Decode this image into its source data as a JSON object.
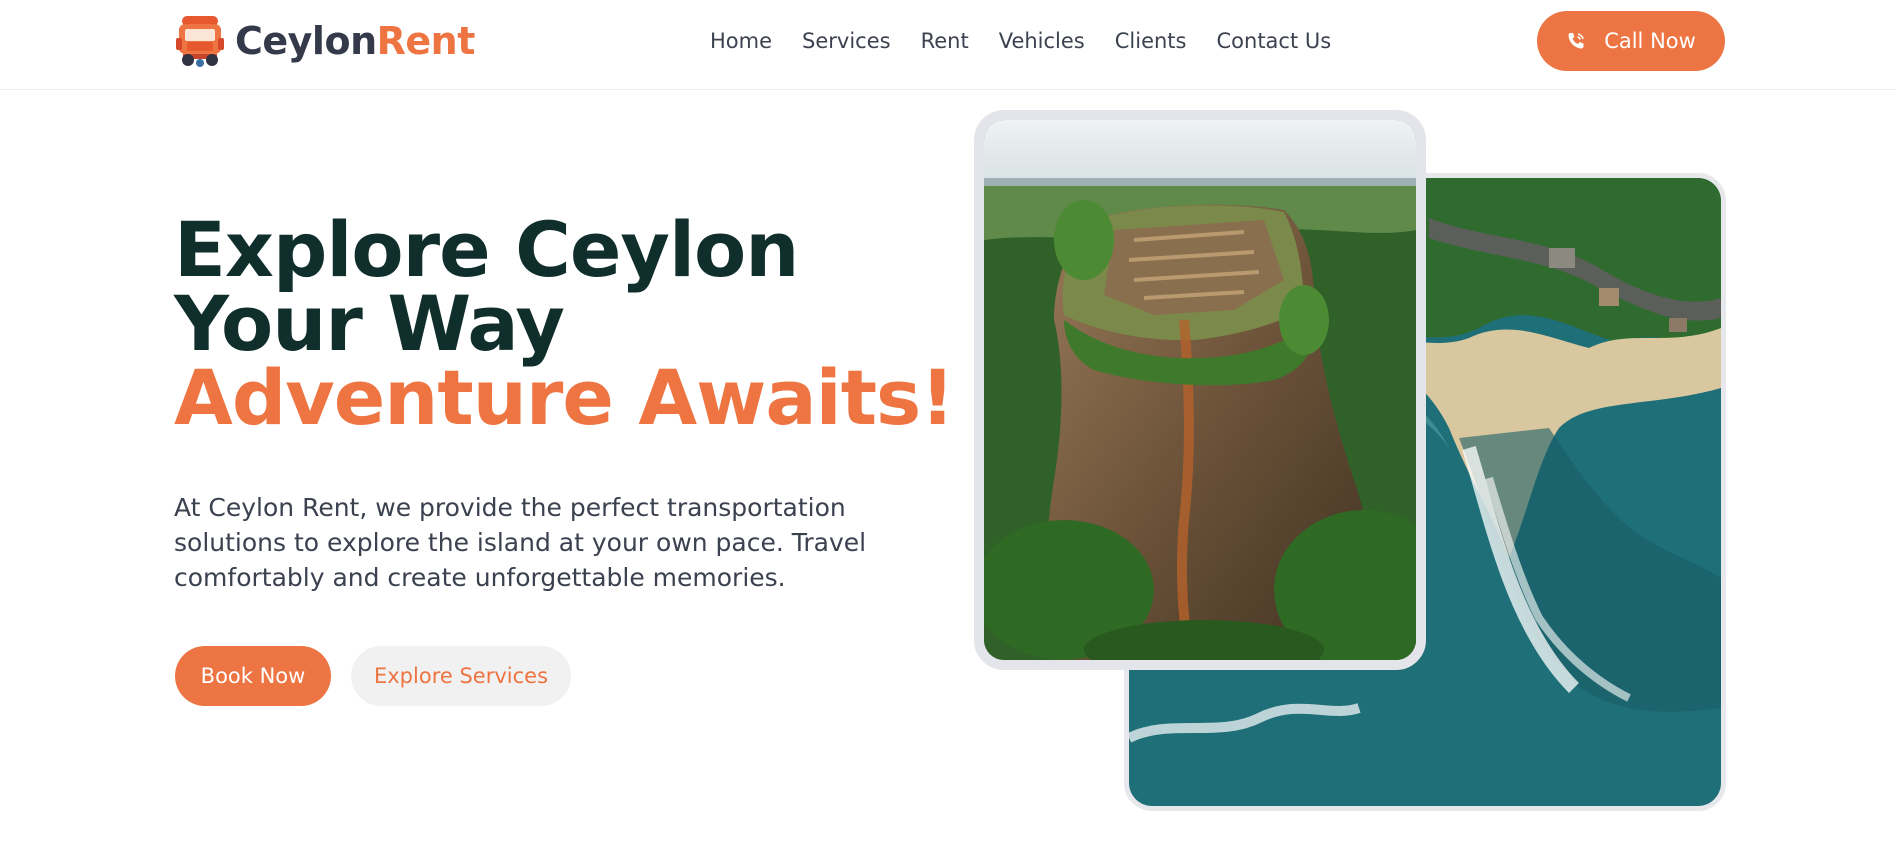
{
  "brand": {
    "name_part1": "Ceylon",
    "name_part2": "Rent"
  },
  "nav": {
    "items": [
      "Home",
      "Services",
      "Rent",
      "Vehicles",
      "Clients",
      "Contact Us"
    ]
  },
  "header": {
    "call_label": "Call Now"
  },
  "hero": {
    "title_line1": "Explore Ceylon",
    "title_line2": "Your Way",
    "title_line3": "Adventure Awaits!",
    "description": "At Ceylon Rent, we provide the perfect transportation solutions to explore the island at your own pace. Travel comfortably and create unforgettable memories.",
    "book_label": "Book Now",
    "explore_label": "Explore Services"
  },
  "colors": {
    "accent": "#ee7441",
    "heading": "#102e2c",
    "text": "#3c4150"
  },
  "icons": {
    "logo": "tuk-tuk-icon",
    "call": "phone-icon"
  }
}
